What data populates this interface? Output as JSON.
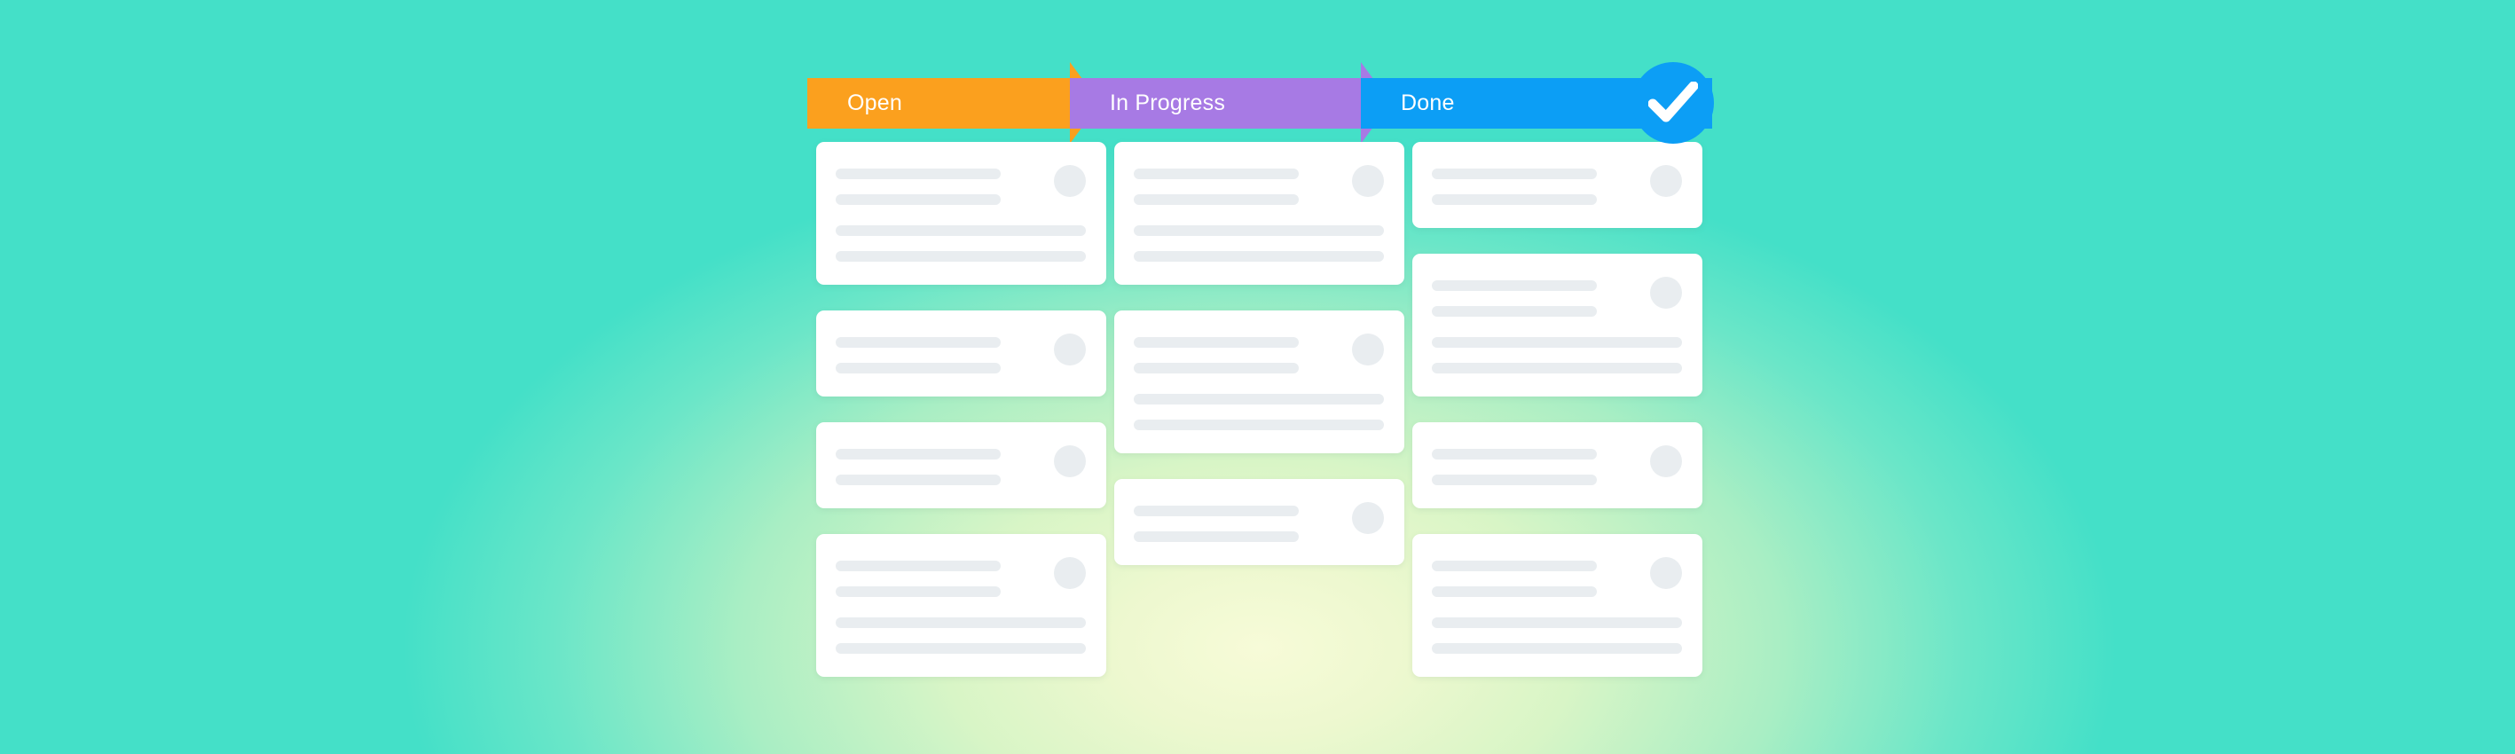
{
  "theme": {
    "background_edge": "#44E0C8",
    "background_glow": "#F7FBD8",
    "card_background": "#FFFFFF",
    "placeholder_grey": "#E9EDF0"
  },
  "pipeline": {
    "name": "kanban-status-pipeline",
    "stages": [
      {
        "id": "open",
        "label": "Open",
        "color": "#FBA01E",
        "shape": "arrow"
      },
      {
        "id": "in-progress",
        "label": "In Progress",
        "color": "#A77AE4",
        "shape": "arrow"
      },
      {
        "id": "done",
        "label": "Done",
        "color": "#0C9EF5",
        "shape": "bar"
      }
    ],
    "completion_badge": {
      "icon": "check-icon",
      "color": "#0C9EF5",
      "glyph_color": "#FFFFFF"
    }
  },
  "board": {
    "columns": [
      {
        "stage_id": "open",
        "stage_label": "Open",
        "cards": [
          {
            "top_lines": 2,
            "bottom_lines": 2,
            "avatar": true
          },
          {
            "top_lines": 2,
            "bottom_lines": 0,
            "avatar": true
          },
          {
            "top_lines": 2,
            "bottom_lines": 0,
            "avatar": true
          },
          {
            "top_lines": 2,
            "bottom_lines": 2,
            "avatar": true
          }
        ]
      },
      {
        "stage_id": "in-progress",
        "stage_label": "In Progress",
        "cards": [
          {
            "top_lines": 2,
            "bottom_lines": 2,
            "avatar": true
          },
          {
            "top_lines": 2,
            "bottom_lines": 2,
            "avatar": true
          },
          {
            "top_lines": 2,
            "bottom_lines": 0,
            "avatar": true
          }
        ]
      },
      {
        "stage_id": "done",
        "stage_label": "Done",
        "cards": [
          {
            "top_lines": 2,
            "bottom_lines": 0,
            "avatar": true
          },
          {
            "top_lines": 2,
            "bottom_lines": 2,
            "avatar": true
          },
          {
            "top_lines": 2,
            "bottom_lines": 0,
            "avatar": true
          },
          {
            "top_lines": 2,
            "bottom_lines": 2,
            "avatar": true
          }
        ]
      }
    ]
  }
}
